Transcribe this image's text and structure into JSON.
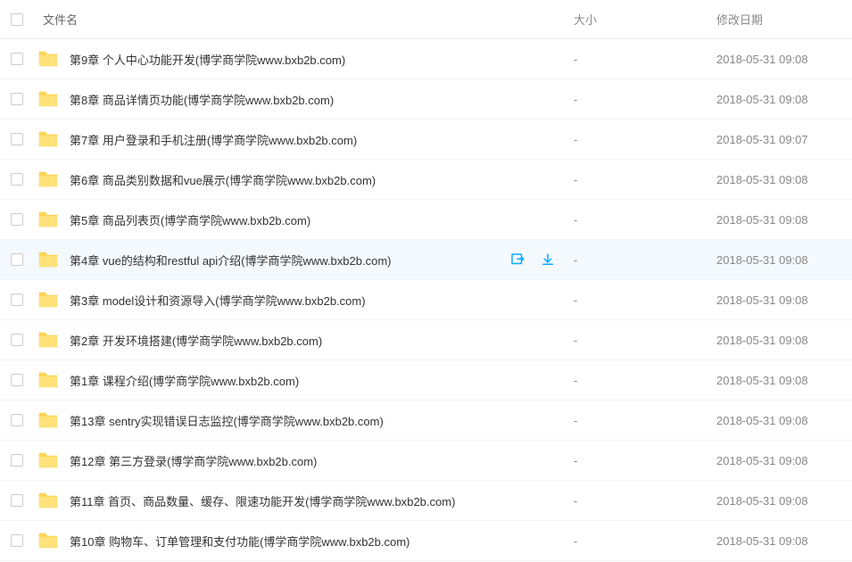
{
  "columns": {
    "name": "文件名",
    "size": "大小",
    "date": "修改日期"
  },
  "files": [
    {
      "name": "第9章 个人中心功能开发(博学商学院www.bxb2b.com)",
      "size": "-",
      "date": "2018-05-31 09:08",
      "hovered": false
    },
    {
      "name": "第8章 商品详情页功能(博学商学院www.bxb2b.com)",
      "size": "-",
      "date": "2018-05-31 09:08",
      "hovered": false
    },
    {
      "name": "第7章 用户登录和手机注册(博学商学院www.bxb2b.com)",
      "size": "-",
      "date": "2018-05-31 09:07",
      "hovered": false
    },
    {
      "name": "第6章 商品类别数据和vue展示(博学商学院www.bxb2b.com)",
      "size": "-",
      "date": "2018-05-31 09:08",
      "hovered": false
    },
    {
      "name": "第5章 商品列表页(博学商学院www.bxb2b.com)",
      "size": "-",
      "date": "2018-05-31 09:08",
      "hovered": false
    },
    {
      "name": "第4章 vue的结构和restful api介绍(博学商学院www.bxb2b.com)",
      "size": "-",
      "date": "2018-05-31 09:08",
      "hovered": true
    },
    {
      "name": "第3章 model设计和资源导入(博学商学院www.bxb2b.com)",
      "size": "-",
      "date": "2018-05-31 09:08",
      "hovered": false
    },
    {
      "name": "第2章 开发环境搭建(博学商学院www.bxb2b.com)",
      "size": "-",
      "date": "2018-05-31 09:08",
      "hovered": false
    },
    {
      "name": "第1章 课程介绍(博学商学院www.bxb2b.com)",
      "size": "-",
      "date": "2018-05-31 09:08",
      "hovered": false
    },
    {
      "name": "第13章 sentry实现错误日志监控(博学商学院www.bxb2b.com)",
      "size": "-",
      "date": "2018-05-31 09:08",
      "hovered": false
    },
    {
      "name": "第12章 第三方登录(博学商学院www.bxb2b.com)",
      "size": "-",
      "date": "2018-05-31 09:08",
      "hovered": false
    },
    {
      "name": "第11章 首页、商品数量、缓存、限速功能开发(博学商学院www.bxb2b.com)",
      "size": "-",
      "date": "2018-05-31 09:08",
      "hovered": false
    },
    {
      "name": "第10章 购物车、订单管理和支付功能(博学商学院www.bxb2b.com)",
      "size": "-",
      "date": "2018-05-31 09:08",
      "hovered": false
    }
  ]
}
